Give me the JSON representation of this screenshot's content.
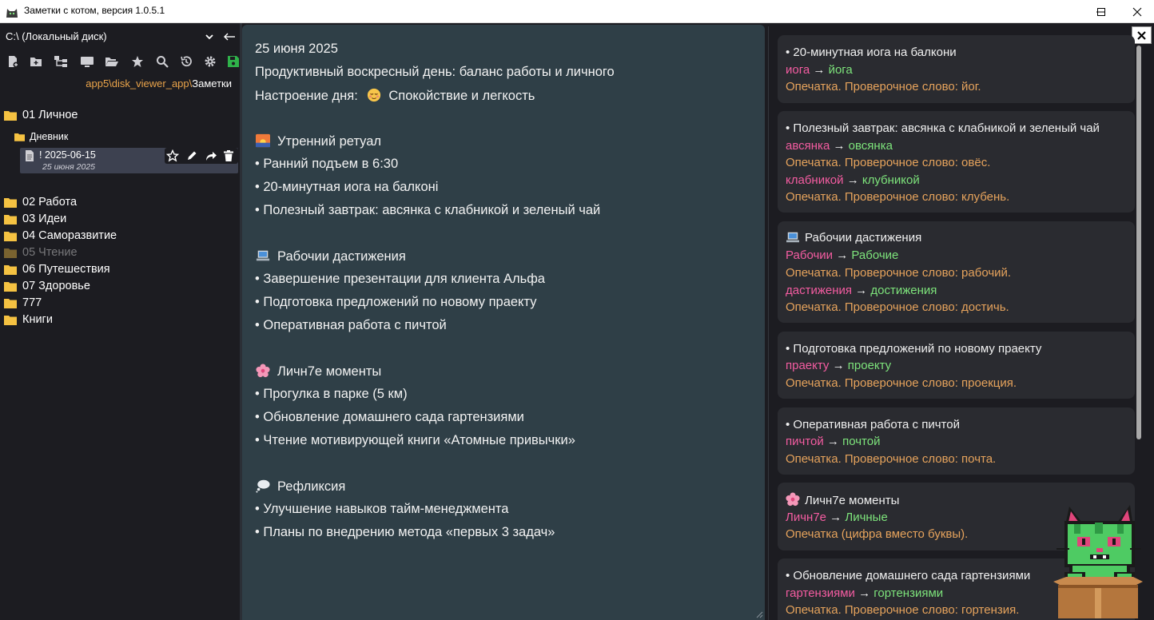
{
  "window": {
    "title": "Заметки с котом, версия 1.0.5.1"
  },
  "sidebar": {
    "drive": "C:\\ (Локальный диск)",
    "breadcrumb": {
      "part1": "app5",
      "sep1": "\\",
      "part2": "disk_viewer_app",
      "sep2": "\\",
      "current": "Заметки"
    },
    "tree": {
      "personal": "01 Личное",
      "diary": "Дневник",
      "note_title": "! 2025-06-15",
      "note_date": "25 июня 2025",
      "items": [
        "02 Работа",
        "03 Идеи",
        "04 Саморазвитие",
        "05 Чтение",
        "06 Путешествия",
        "07 Здоровье",
        "777",
        "Книги"
      ]
    },
    "toolbar_icons": [
      "new-file-icon",
      "new-folder-icon",
      "tree-icon",
      "computer-icon",
      "open-folder-icon",
      "star-icon",
      "search-icon",
      "history-icon",
      "gear-icon",
      "save-icon"
    ]
  },
  "editor": {
    "lines": [
      "25 июня 2025",
      "Продуктивный воскресный день: баланс работы и личного",
      "Настроение дня:",
      "Спокойствие и легкость",
      "Утренний ретуал",
      "• Ранний подъем в 6:30",
      "• 20-минутная иога на балконі",
      "• Полезный завтрак: авсянка с клабникой и зеленый чай",
      "Рабочии дастижения",
      "• Завершение презентации для клиента Альфа",
      "• Подготовка предложений по новому праекту",
      "• Оперативная работа с пичтой",
      "Личн7е моменты",
      "• Прогулка в парке (5 км)",
      "• Обновление домашнего сада гартензиями",
      "• Чтение мотивирующей книги «Атомные привычки»",
      "Рефликсия",
      "• Улучшение навыков тайм-менеджмента",
      "• Планы по внедрению метода «первых 3 задач»"
    ]
  },
  "corrections": [
    {
      "heading": "• 20-минутная иога на балкони",
      "pairs": [
        {
          "wrong": "иога",
          "right": "йога",
          "note": "Опечатка. Проверочное слово: йог."
        }
      ]
    },
    {
      "heading": "• Полезный завтрак: авсянка с клабникой и зеленый чай",
      "pairs": [
        {
          "wrong": "авсянка",
          "right": "овсянка",
          "note": "Опечатка. Проверочное слово: овёс."
        },
        {
          "wrong": "клабникой",
          "right": "клубникой",
          "note": "Опечатка. Проверочное слово: клубень."
        }
      ]
    },
    {
      "heading": "Рабочии дастижения",
      "pairs": [
        {
          "wrong": "Рабочии",
          "right": "Рабочие",
          "note": "Опечатка. Проверочное слово: рабочий."
        },
        {
          "wrong": "дастижения",
          "right": "достижения",
          "note": "Опечатка. Проверочное слово: достичь."
        }
      ]
    },
    {
      "heading": "• Подготовка предложений по новому праекту",
      "pairs": [
        {
          "wrong": "праекту",
          "right": "проекту",
          "note": "Опечатка. Проверочное слово: проекция."
        }
      ]
    },
    {
      "heading": "• Оперативная работа с пичтой",
      "pairs": [
        {
          "wrong": "пичтой",
          "right": "почтой",
          "note": "Опечатка. Проверочное слово: почта."
        }
      ]
    },
    {
      "heading": "Личн7е моменты",
      "pairs": [
        {
          "wrong": "Личн7е",
          "right": "Личные",
          "note": "Опечатка (цифра вместо буквы)."
        }
      ]
    },
    {
      "heading": "• Обновление домашнего сада гартензиями",
      "pairs": [
        {
          "wrong": "гартензиями",
          "right": "гортензиями",
          "note": "Опечатка. Проверочное слово: гортензия."
        }
      ]
    }
  ],
  "colors": {
    "accent_folder": "#f5c242",
    "wrong_word": "#f45ca1",
    "right_word": "#7de37b",
    "note_text": "#e6a35c",
    "editor_bg": "#2f3f47"
  }
}
